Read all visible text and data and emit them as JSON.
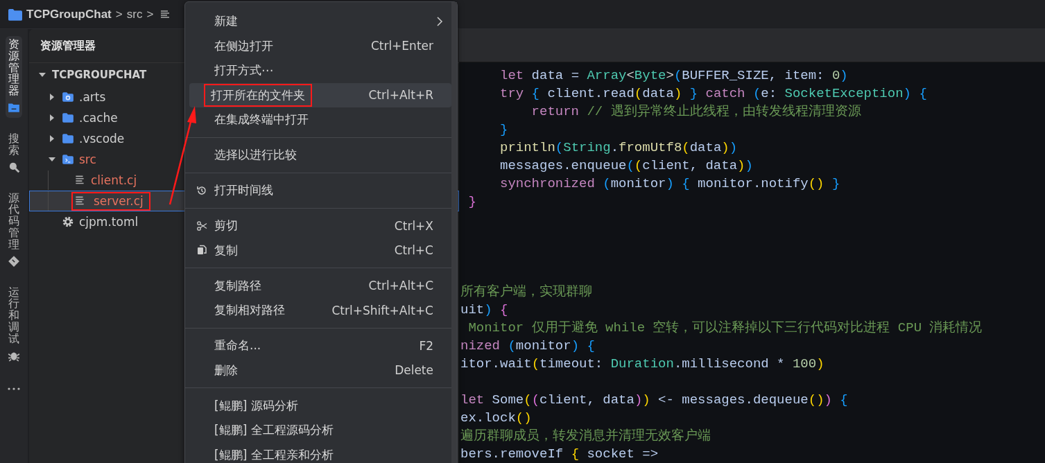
{
  "breadcrumb": {
    "items": [
      {
        "kind": "folder",
        "label": "TCPGroupChat"
      },
      {
        "kind": "separator",
        "label": ">"
      },
      {
        "kind": "text",
        "label": "src"
      },
      {
        "kind": "separator",
        "label": ">"
      },
      {
        "kind": "file"
      }
    ]
  },
  "activity_bar": {
    "items": [
      {
        "kind": "files",
        "label": "资源管理器",
        "selected": true
      },
      {
        "kind": "search",
        "label": "搜索",
        "selected": false
      },
      {
        "kind": "source-control",
        "label": "源代码管理",
        "selected": false
      },
      {
        "kind": "debug",
        "label": "运行和调试",
        "selected": false
      },
      {
        "kind": "more"
      }
    ]
  },
  "explorer": {
    "title": "资源管理器",
    "tree": {
      "label": "TCPGROUPCHAT",
      "expanded": true,
      "children": [
        {
          "label": ".arts",
          "kind": "folder-gear",
          "expanded": false,
          "selected": false,
          "modified": false,
          "annotated": false
        },
        {
          "label": ".cache",
          "kind": "folder",
          "expanded": false,
          "selected": false,
          "modified": false,
          "annotated": false
        },
        {
          "label": ".vscode",
          "kind": "folder",
          "expanded": false,
          "selected": false,
          "modified": false,
          "annotated": false
        },
        {
          "label": "src",
          "kind": "folder-terminal",
          "expanded": true,
          "selected": false,
          "modified": true,
          "annotated": false,
          "children": [
            {
              "label": "client.cj",
              "kind": "file",
              "selected": false,
              "modified": true,
              "annotated": false
            },
            {
              "label": "server.cj",
              "kind": "file",
              "selected": true,
              "modified": true,
              "annotated": true
            }
          ]
        },
        {
          "label": "cjpm.toml",
          "kind": "gear",
          "selected": false,
          "modified": false,
          "annotated": false
        }
      ]
    }
  },
  "context_menu": {
    "items": [
      {
        "kind": "item",
        "label": "新建",
        "submenu": true,
        "selected": false,
        "annotated": false
      },
      {
        "kind": "item",
        "label": "在侧边打开",
        "shortcut": "Ctrl+Enter",
        "submenu": false,
        "selected": false,
        "annotated": false
      },
      {
        "kind": "item",
        "label": "打开方式⋯",
        "submenu": false,
        "selected": false,
        "annotated": false
      },
      {
        "kind": "item",
        "label": "打开所在的文件夹",
        "shortcut": "Ctrl+Alt+R",
        "submenu": false,
        "selected": true,
        "annotated": true
      },
      {
        "kind": "item",
        "label": "在集成终端中打开",
        "submenu": false,
        "selected": false,
        "annotated": false
      },
      {
        "kind": "separator"
      },
      {
        "kind": "item",
        "label": "选择以进行比较",
        "submenu": false,
        "selected": false,
        "annotated": false
      },
      {
        "kind": "separator"
      },
      {
        "kind": "history-item",
        "label": "打开时间线",
        "submenu": false,
        "selected": false,
        "annotated": false
      },
      {
        "kind": "separator"
      },
      {
        "kind": "cut-item",
        "label": "剪切",
        "shortcut": "Ctrl+X",
        "submenu": false,
        "selected": false,
        "annotated": false
      },
      {
        "kind": "copy-item",
        "label": "复制",
        "shortcut": "Ctrl+C",
        "submenu": false,
        "selected": false,
        "annotated": false
      },
      {
        "kind": "separator"
      },
      {
        "kind": "item",
        "label": "复制路径",
        "shortcut": "Ctrl+Alt+C",
        "submenu": false,
        "selected": false,
        "annotated": false
      },
      {
        "kind": "item",
        "label": "复制相对路径",
        "shortcut": "Ctrl+Shift+Alt+C",
        "submenu": false,
        "selected": false,
        "annotated": false
      },
      {
        "kind": "separator"
      },
      {
        "kind": "item",
        "label": "重命名...",
        "shortcut": "F2",
        "submenu": false,
        "selected": false,
        "annotated": false
      },
      {
        "kind": "item",
        "label": "删除",
        "shortcut": "Delete",
        "submenu": false,
        "selected": false,
        "annotated": false
      },
      {
        "kind": "separator"
      },
      {
        "kind": "item",
        "label": "[鲲鹏] 源码分析",
        "submenu": false,
        "selected": false,
        "annotated": false
      },
      {
        "kind": "item",
        "label": "[鲲鹏] 全工程源码分析",
        "submenu": false,
        "selected": false,
        "annotated": false
      },
      {
        "kind": "item",
        "label": "[鲲鹏] 全工程亲和分析",
        "submenu": false,
        "selected": false,
        "annotated": false
      }
    ]
  },
  "editor": {
    "lines": [
      {
        "kind": "indented",
        "tokens": [
          {
            "kind": "kw",
            "text": "let"
          },
          {
            "kind": "id",
            "text": " data = "
          },
          {
            "kind": "type",
            "text": "Array"
          },
          {
            "kind": "op",
            "text": "<"
          },
          {
            "kind": "type",
            "text": "Byte"
          },
          {
            "kind": "op",
            "text": ">"
          },
          {
            "kind": "p2",
            "text": "("
          },
          {
            "kind": "id",
            "text": "BUFFER_SIZE, item: "
          },
          {
            "kind": "num",
            "text": "0"
          },
          {
            "kind": "p2",
            "text": ")"
          }
        ]
      },
      {
        "kind": "indented",
        "tokens": [
          {
            "kind": "kw",
            "text": "try"
          },
          {
            "kind": "p2",
            "text": " { "
          },
          {
            "kind": "id",
            "text": "client.read"
          },
          {
            "kind": "p1",
            "text": "("
          },
          {
            "kind": "id",
            "text": "data"
          },
          {
            "kind": "p1",
            "text": ")"
          },
          {
            "kind": "p2",
            "text": " } "
          },
          {
            "kind": "kw",
            "text": "catch"
          },
          {
            "kind": "p2",
            "text": " ("
          },
          {
            "kind": "id",
            "text": "e: "
          },
          {
            "kind": "type",
            "text": "SocketException"
          },
          {
            "kind": "p2",
            "text": ") {"
          }
        ]
      },
      {
        "kind": "deep",
        "tokens": [
          {
            "kind": "kw",
            "text": "return"
          },
          {
            "kind": "cmt",
            "text": " // 遇到异常终止此线程，由转发线程清理资源"
          }
        ]
      },
      {
        "kind": "indented",
        "tokens": [
          {
            "kind": "p2",
            "text": "}"
          }
        ]
      },
      {
        "kind": "indented",
        "tokens": [
          {
            "kind": "fn",
            "text": "println"
          },
          {
            "kind": "p2",
            "text": "("
          },
          {
            "kind": "type",
            "text": "String"
          },
          {
            "kind": "id",
            "text": "."
          },
          {
            "kind": "fn",
            "text": "fromUtf8"
          },
          {
            "kind": "p1",
            "text": "("
          },
          {
            "kind": "id",
            "text": "data"
          },
          {
            "kind": "p1",
            "text": ")"
          },
          {
            "kind": "p2",
            "text": ")"
          }
        ]
      },
      {
        "kind": "indented",
        "tokens": [
          {
            "kind": "id",
            "text": "messages.enqueue"
          },
          {
            "kind": "p2",
            "text": "("
          },
          {
            "kind": "p1",
            "text": "("
          },
          {
            "kind": "id",
            "text": "client, data"
          },
          {
            "kind": "p1",
            "text": ")"
          },
          {
            "kind": "p2",
            "text": ")"
          }
        ]
      },
      {
        "kind": "indented",
        "tokens": [
          {
            "kind": "kw",
            "text": "synchronized"
          },
          {
            "kind": "p2",
            "text": " ("
          },
          {
            "kind": "id",
            "text": "monitor"
          },
          {
            "kind": "p2",
            "text": ") { "
          },
          {
            "kind": "id",
            "text": "monitor.notify"
          },
          {
            "kind": "p1",
            "text": "()"
          },
          {
            "kind": "p2",
            "text": " }"
          }
        ]
      },
      {
        "kind": "block",
        "tokens": [
          {
            "kind": "p3",
            "text": "}"
          }
        ]
      },
      {
        "kind": "blank"
      },
      {
        "kind": "blank"
      },
      {
        "kind": "blank"
      },
      {
        "kind": "blank"
      },
      {
        "kind": "code",
        "tokens": [
          {
            "kind": "cmt",
            "text": "所有客户端，实现群聊"
          }
        ]
      },
      {
        "kind": "code",
        "tokens": [
          {
            "kind": "id",
            "text": "uit"
          },
          {
            "kind": "p2",
            "text": ")"
          },
          {
            "kind": "p3",
            "text": " {"
          }
        ]
      },
      {
        "kind": "code",
        "tokens": [
          {
            "kind": "cmt",
            "text": " Monitor 仅用于避免 while 空转，可以注释掉以下三行代码对比进程 CPU 消耗情况"
          }
        ]
      },
      {
        "kind": "code",
        "tokens": [
          {
            "kind": "kw",
            "text": "nized"
          },
          {
            "kind": "p2",
            "text": " ("
          },
          {
            "kind": "id",
            "text": "monitor"
          },
          {
            "kind": "p2",
            "text": ") {"
          }
        ]
      },
      {
        "kind": "code",
        "tokens": [
          {
            "kind": "id",
            "text": "itor.wait"
          },
          {
            "kind": "p1",
            "text": "("
          },
          {
            "kind": "id",
            "text": "timeout: "
          },
          {
            "kind": "type",
            "text": "Duration"
          },
          {
            "kind": "id",
            "text": ".millisecond * "
          },
          {
            "kind": "num",
            "text": "100"
          },
          {
            "kind": "p1",
            "text": ")"
          }
        ]
      },
      {
        "kind": "blank"
      },
      {
        "kind": "code",
        "tokens": [
          {
            "kind": "kw",
            "text": "let"
          },
          {
            "kind": "id",
            "text": " Some"
          },
          {
            "kind": "p1",
            "text": "("
          },
          {
            "kind": "p3",
            "text": "("
          },
          {
            "kind": "id",
            "text": "client, data"
          },
          {
            "kind": "p3",
            "text": ")"
          },
          {
            "kind": "p1",
            "text": ")"
          },
          {
            "kind": "id",
            "text": " <- messages.dequeue"
          },
          {
            "kind": "p1",
            "text": "()"
          },
          {
            "kind": "p3",
            "text": ")"
          },
          {
            "kind": "p2",
            "text": " {"
          }
        ]
      },
      {
        "kind": "code",
        "tokens": [
          {
            "kind": "id",
            "text": "ex.lock"
          },
          {
            "kind": "p1",
            "text": "()"
          }
        ]
      },
      {
        "kind": "code",
        "tokens": [
          {
            "kind": "cmt",
            "text": "遍历群聊成员，转发消息并清理无效客户端"
          }
        ]
      },
      {
        "kind": "code",
        "tokens": [
          {
            "kind": "id",
            "text": "bers.removeIf "
          },
          {
            "kind": "p1",
            "text": "{"
          },
          {
            "kind": "id",
            "text": " socket =>"
          }
        ]
      }
    ]
  },
  "annotation": {
    "arrow": true
  }
}
